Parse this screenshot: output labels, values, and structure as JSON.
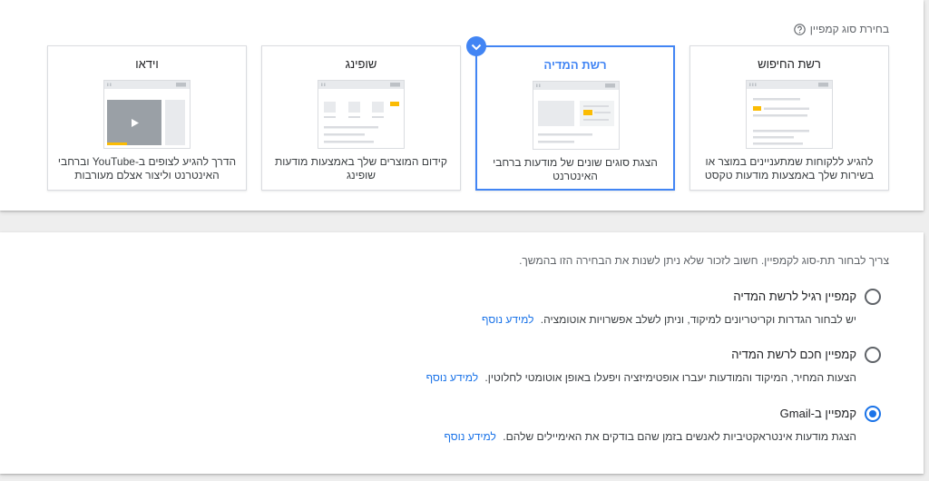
{
  "campaign_type": {
    "heading": "בחירת סוג קמפיין",
    "help_icon": "help-circle-icon",
    "selected_icon": "chevron-check-icon",
    "cards": [
      {
        "title": "רשת החיפוש",
        "description": "להגיע ללקוחות שמתעניינים במוצר או בשירות שלך באמצעות מודעות טקסט",
        "illustration": "search-ad-illustration",
        "selected": false
      },
      {
        "title": "רשת המדיה",
        "description": "הצגת סוגים שונים של מודעות ברחבי האינטרנט",
        "illustration": "display-ad-illustration",
        "selected": true
      },
      {
        "title": "שופינג",
        "description": "קידום המוצרים שלך באמצעות מודעות שופינג",
        "illustration": "shopping-ad-illustration",
        "selected": false
      },
      {
        "title": "וידאו",
        "description": "הדרך להגיע לצופים ב-YouTube וברחבי האינטרנט וליצור אצלם מעורבות",
        "illustration": "video-ad-illustration",
        "selected": false
      }
    ]
  },
  "subtype": {
    "instruction": "צריך לבחור תת-סוג לקמפיין. חשוב לזכור שלא ניתן לשנות את הבחירה הזו בהמשך.",
    "options": [
      {
        "label": "קמפיין רגיל לרשת המדיה",
        "description": "יש לבחור הגדרות וקריטריונים למיקוד, וניתן לשלב אפשרויות אוטומציה.",
        "link": "למידע נוסף",
        "selected": false
      },
      {
        "label": "קמפיין חכם לרשת המדיה",
        "description": "הצעות המחיר, המיקוד והמודעות יעברו אופטימיזציה ויפעלו באופן אוטומטי לחלוטין.",
        "link": "למידע נוסף",
        "selected": false
      },
      {
        "label": "קמפיין ב-Gmail",
        "description": "הצגת מודעות אינטראקטיביות לאנשים בזמן שהם בודקים את האימיילים שלהם.",
        "link": "למידע נוסף",
        "selected": true
      }
    ]
  },
  "colors": {
    "accent": "#4285f4",
    "link": "#1a73e8",
    "highlight": "#fbbc04",
    "text": "#3c4043",
    "muted": "#5f6368",
    "heading": "#202124"
  }
}
